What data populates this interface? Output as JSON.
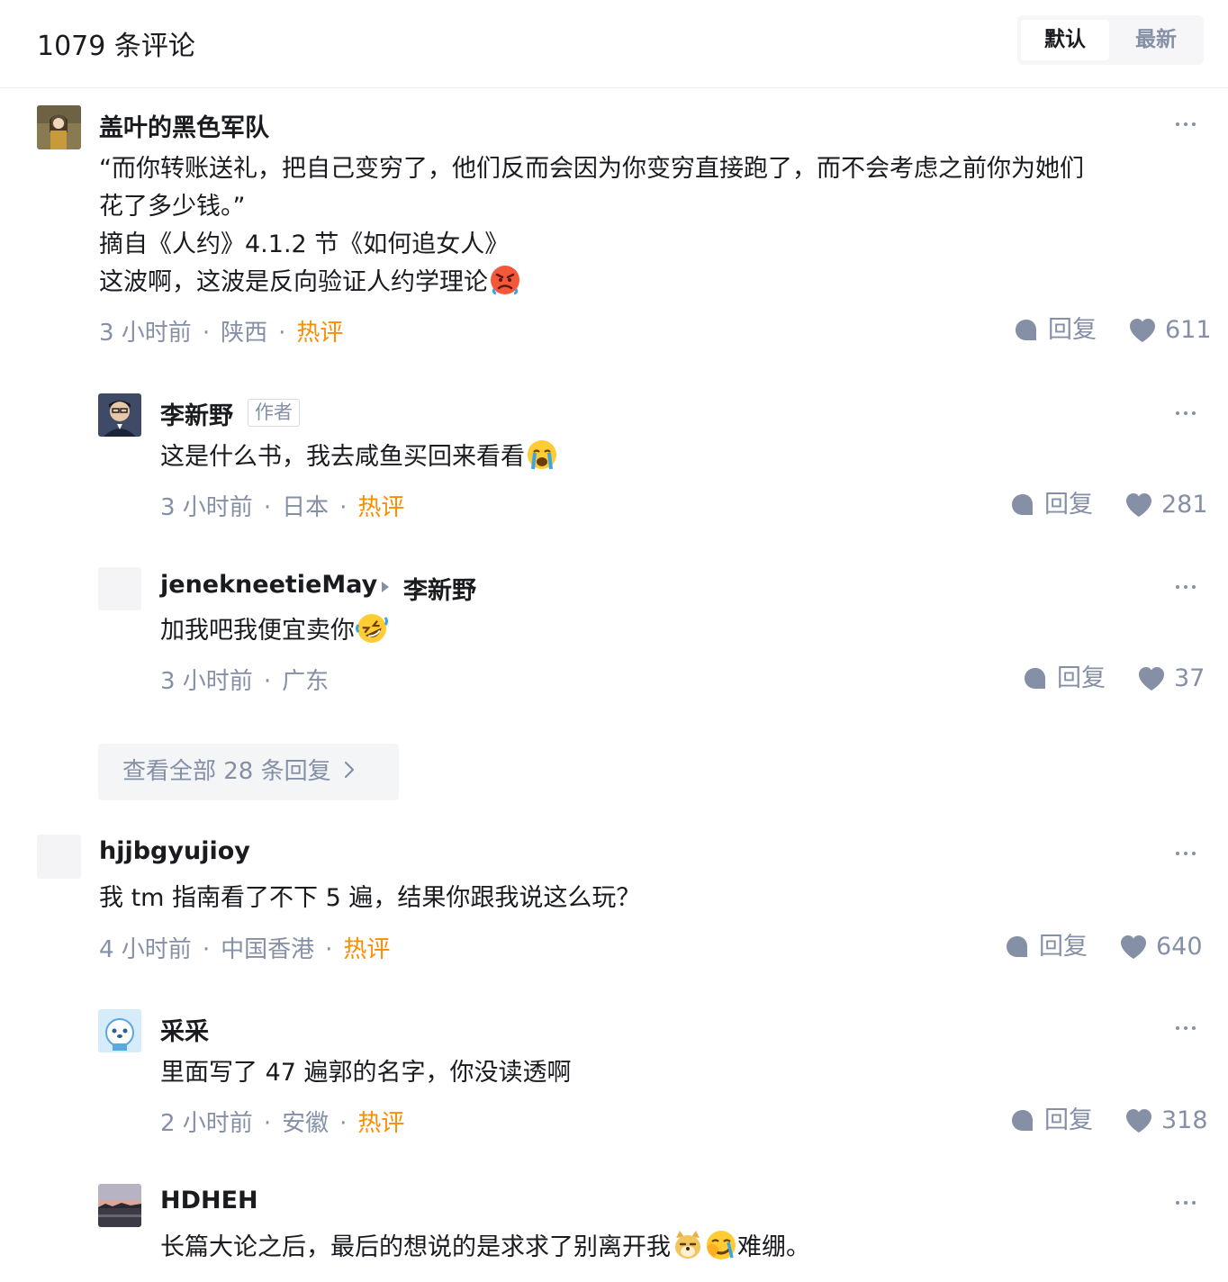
{
  "header": {
    "title": "1079 条评论",
    "sort_default": "默认",
    "sort_latest": "最新"
  },
  "labels": {
    "reply": "回复",
    "hot": "热评",
    "author_badge": "作者"
  },
  "comments": [
    {
      "author": "盖叶的黑色军队",
      "lines": [
        "“而你转账送礼，把自己变穷了，他们反而会因为你变穷直接跑了，而不会考虑之前你为她们",
        "花了多少钱。”",
        "摘自《人约》4.1.2 节《如何追女人》",
        "这波啊，这波是反向验证人约学理论"
      ],
      "emoji": "angry-face-emoji",
      "time": "3 小时前",
      "location": "陕西",
      "likes": "611"
    },
    {
      "author": "李新野",
      "text": "这是什么书，我去咸鱼买回来看看",
      "emoji": "crying-face-emoji",
      "time": "3 小时前",
      "location": "日本",
      "likes": "281"
    },
    {
      "author": "jeneknee​tieMay",
      "reply_to": "李新野",
      "text": "加我吧我便宜卖你",
      "emoji": "rofl-emoji",
      "time": "3 小时前",
      "location": "广东",
      "likes": "37"
    },
    {
      "author": "hjjbgyujioy",
      "text": "我 tm 指南看了不下 5 遍，结果你跟我说这么玩？",
      "time": "4 小时前",
      "location": "中国香港",
      "likes": "640"
    },
    {
      "author": "采采",
      "text": "里面写了 47 遍郭的名字，你没读透啊",
      "time": "2 小时前",
      "location": "安徽",
      "likes": "318"
    },
    {
      "author": "HDHEH",
      "text_before": "长篇大论之后，最后的想说的是求求了别离开我",
      "text_after": "难绷。",
      "emojis": [
        "doge-emoji",
        "facepalm-cry-emoji"
      ]
    }
  ],
  "view_all_replies": "查看全部 28 条回复"
}
